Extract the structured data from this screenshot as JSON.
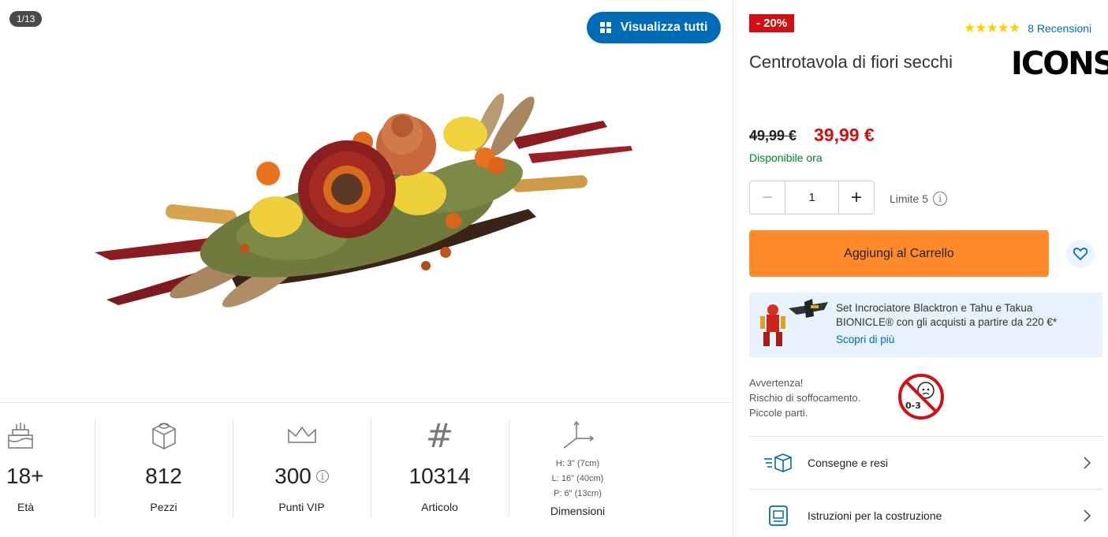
{
  "gallery": {
    "counter": "1/13",
    "view_all_label": "Visualizza tutti"
  },
  "specs": [
    {
      "icon": "birthday-cake-icon",
      "value": "18+",
      "label": "Età"
    },
    {
      "icon": "brick-icon",
      "value": "812",
      "label": "Pezzi"
    },
    {
      "icon": "crown-icon",
      "value": "300",
      "label": "Punti VIP"
    },
    {
      "icon": "hash-icon",
      "value": "10314",
      "label": "Articolo"
    },
    {
      "icon": "dimensions-icon",
      "label": "Dimensioni",
      "dims": [
        "H: 3\" (7cm)",
        "L: 16\" (40cm)",
        "P: 6\" (13cm)"
      ]
    }
  ],
  "product": {
    "discount_badge": "- 20%",
    "rating_stars": 5,
    "reviews_label": "8 Recensioni",
    "brand": "ICONS",
    "title": "Centrotavola di fiori secchi",
    "price_old": "49,99 €",
    "price_new": "39,99 €",
    "availability": "Disponibile ora",
    "quantity": "1",
    "limit_label": "Limite 5",
    "add_to_cart_label": "Aggiungi al Carrello"
  },
  "promo": {
    "text": "Set Incrociatore Blacktron e Tahu e Takua BIONICLE® con gli acquisti a partire da 220 €*",
    "link": "Scopri di più"
  },
  "warning": {
    "lines": [
      "Avvertenza!",
      "Rischio di soffocamento.",
      "Piccole parti."
    ],
    "badge": "0-3"
  },
  "links": [
    {
      "icon": "delivery-box-icon",
      "label": "Consegne e resi"
    },
    {
      "icon": "instructions-icon",
      "label": "Istruzioni per la costruzione"
    }
  ],
  "colors": {
    "brand_blue": "#006cb7",
    "sale_red": "#d01012",
    "cta_orange": "#ff8a2a",
    "available_green": "#00852b",
    "promo_bg": "#e8f2fc"
  }
}
